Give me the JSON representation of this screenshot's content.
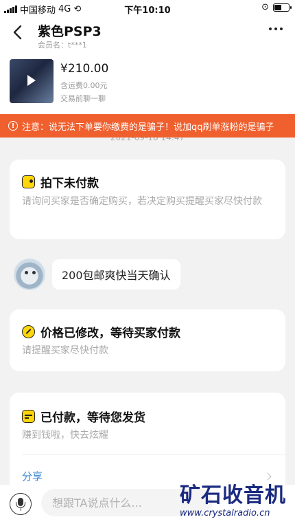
{
  "status_bar": {
    "carrier": "中国移动",
    "network": "4G",
    "time": "下午10:10",
    "battery_level": 0.55
  },
  "header": {
    "title": "紫色PSP3",
    "member": "会员名：t***1"
  },
  "product": {
    "price": "¥210.00",
    "shipping": "含运费0.00元",
    "chat_before": "交易前聊一聊"
  },
  "warning": {
    "text": "注意：说无法下单要你缴费的是骗子！说加qq刷单涨粉的是骗子"
  },
  "timestamp": "2021-09-18 14:47",
  "cards": [
    {
      "title": "拍下未付款",
      "desc": "请询问买家是否确定购买，若决定购买提醒买家尽快付款",
      "icon": "wallet-icon"
    },
    {
      "title": "价格已修改，等待买家付款",
      "desc": "请提醒买家尽快付款",
      "icon": "edit-price-icon"
    },
    {
      "title": "已付款，等待您发货",
      "desc": "赚到钱啦，快去炫耀",
      "icon": "shipping-box-icon",
      "share": "分享"
    }
  ],
  "message": {
    "text": "200包邮爽快当天确认"
  },
  "input": {
    "placeholder": "想跟TA说点什么..."
  },
  "watermark": {
    "cn": "矿石收音机",
    "url": "www.crystalradio.cn"
  },
  "colors": {
    "warning_bg": "#f0602e",
    "icon_yellow": "#ffd60a",
    "link_blue": "#3a86d8"
  }
}
